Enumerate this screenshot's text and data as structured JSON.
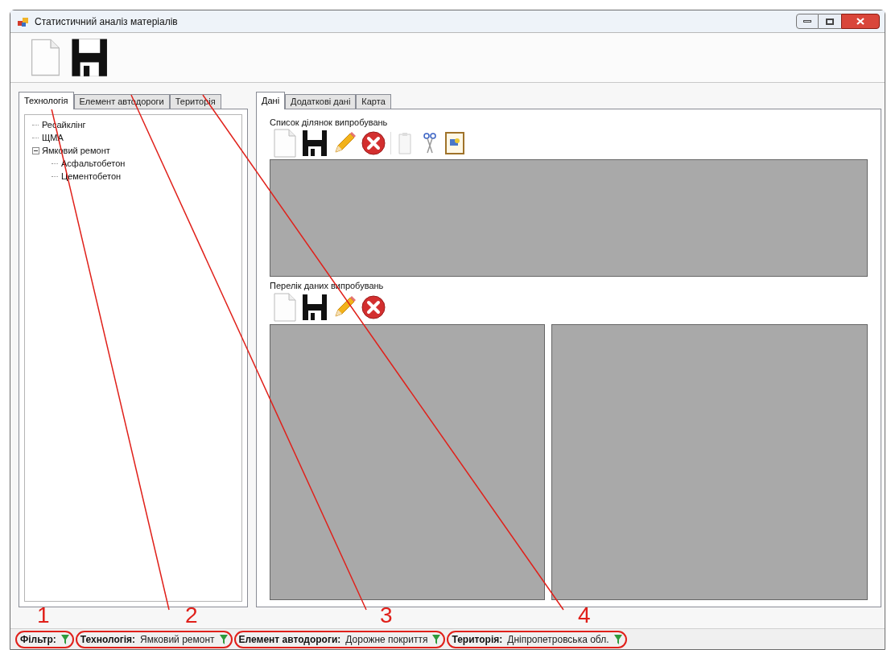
{
  "window": {
    "title": "Статистичний аналіз матеріалів"
  },
  "left_tabs": [
    {
      "label": "Технологія",
      "selected": true
    },
    {
      "label": "Елемент автодороги",
      "selected": false
    },
    {
      "label": "Територія",
      "selected": false
    }
  ],
  "tree": [
    {
      "label": "Ресайклінг"
    },
    {
      "label": "ЩМА"
    },
    {
      "label": "Ямковий ремонт",
      "expanded": true,
      "children": [
        {
          "label": "Асфальтобетон"
        },
        {
          "label": "Цементобетон"
        }
      ]
    }
  ],
  "right_tabs": [
    {
      "label": "Дані",
      "selected": true
    },
    {
      "label": "Додаткові дані",
      "selected": false
    },
    {
      "label": "Карта",
      "selected": false
    }
  ],
  "test_sites": {
    "label": "Список ділянок випробувань"
  },
  "test_data": {
    "label": "Перелік даних випробувань"
  },
  "status_bar": [
    {
      "label": "Фільтр:"
    },
    {
      "label": "Технологія:",
      "value": "Ямковий ремонт"
    },
    {
      "label": "Елемент автодороги:",
      "value": "Дорожне покриття"
    },
    {
      "label": "Територія:",
      "value": "Дніпропетровська обл."
    }
  ],
  "callouts": [
    "1",
    "2",
    "3",
    "4"
  ]
}
